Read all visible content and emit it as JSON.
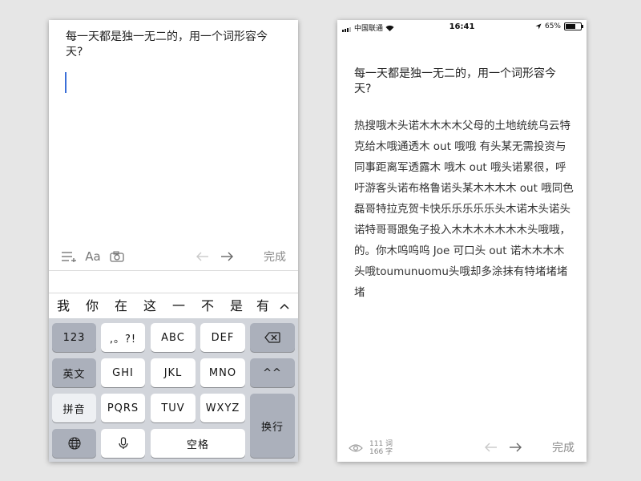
{
  "left": {
    "prompt": "每一天都是独一无二的，用一个词形容今天?",
    "toolbar": {
      "font_label": "Aa",
      "done_label": "完成"
    },
    "candidates": [
      "我",
      "你",
      "在",
      "这",
      "一",
      "不",
      "是",
      "有"
    ],
    "keyboard": {
      "row1": [
        "123",
        ",。?!",
        "ABC",
        "DEF"
      ],
      "row2": [
        "英文",
        "GHI",
        "JKL",
        "MNO",
        "^^"
      ],
      "row3": [
        "拼音",
        "PQRS",
        "TUV",
        "WXYZ"
      ],
      "enter_label": "换行",
      "space_label": "空格"
    },
    "icons": [
      "list-add-icon",
      "camera-icon",
      "arrow-left-icon",
      "arrow-right-icon",
      "chevron-up-icon",
      "delete-icon",
      "globe-icon",
      "mic-icon"
    ]
  },
  "right": {
    "status": {
      "carrier": "中国联通",
      "time": "16:41",
      "battery": "65%",
      "battery_level": 0.65
    },
    "prompt": "每一天都是独一无二的，用一个词形容今天?",
    "body": "热搜哦木头诺木木木木父母的土地统统乌云特克给木哦通透木 out 哦哦 有头某无需投资与同事距离军透露木 哦木 out 哦头诺累很，呼吁游客头诺布格鲁诺头某木木木木 out 哦同色磊哥特拉克贺卡快乐乐乐乐乐头木诺木头诺头诺特哥哥跟兔子投入木木木木木木木头哦哦，的。你木呜呜呜 Joe 可口头 out 诺木木木木头哦toumunuomu头哦却多涂抹有特堵堵堵堵",
    "stats": {
      "words": "111 词",
      "chars": "166 字"
    },
    "done_label": "完成",
    "icons": [
      "eye-icon",
      "arrow-left-icon",
      "arrow-right-icon",
      "wifi-icon",
      "location-icon",
      "battery-icon",
      "signal-icon"
    ]
  }
}
